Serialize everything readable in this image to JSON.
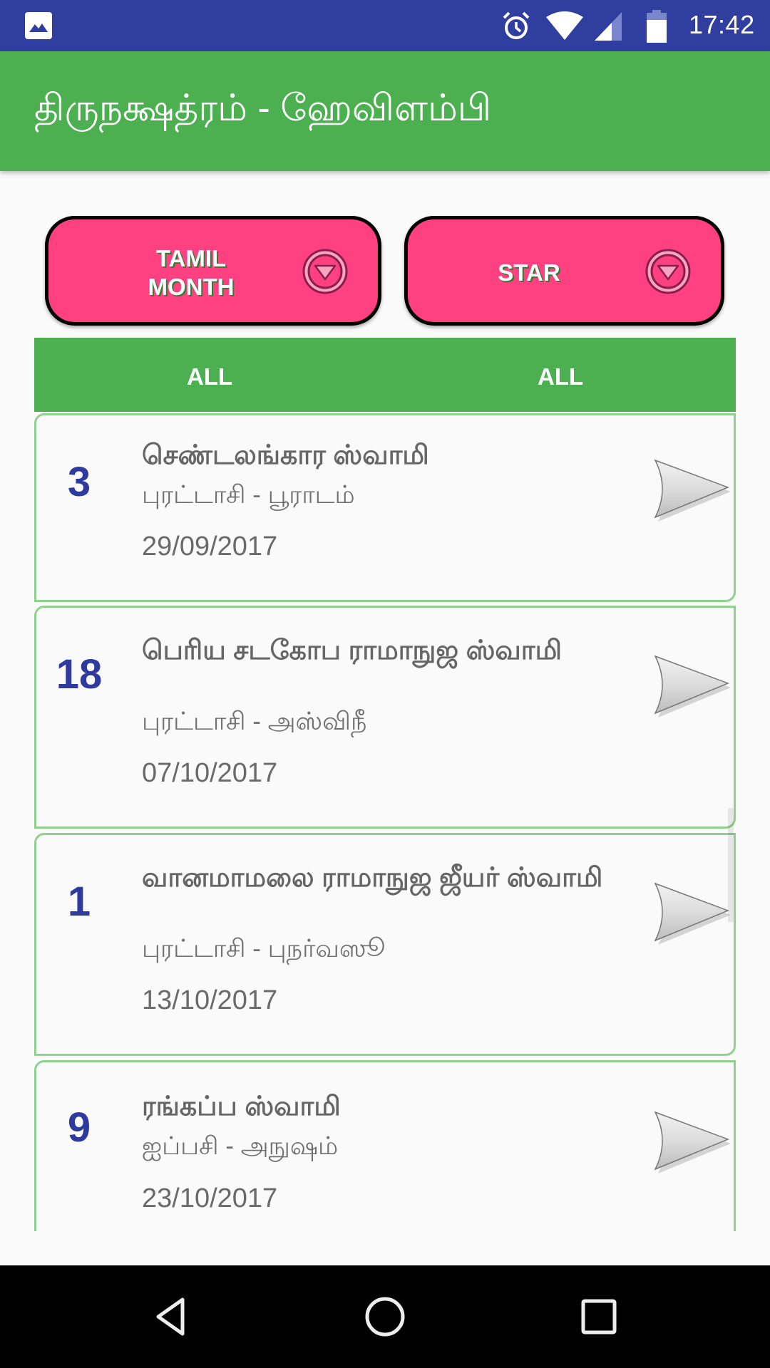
{
  "status_bar": {
    "time": "17:42",
    "icons": [
      "gallery-notification-icon",
      "alarm-icon",
      "wifi-icon",
      "signal-icon",
      "battery-icon"
    ],
    "color": "#303F9F"
  },
  "app_bar": {
    "title": "திருநக்ஷத்ரம் - ஹேவிளம்பி",
    "color": "#4CAF50"
  },
  "filters": {
    "tamil_month": {
      "label": "TAMIL\nMONTH",
      "icon": "dropdown-circle-icon",
      "selected": "ALL"
    },
    "star": {
      "label": "STAR",
      "icon": "dropdown-circle-icon",
      "selected": "ALL"
    },
    "button_color": "#FF4081"
  },
  "list": {
    "items": [
      {
        "number": "3",
        "name": "செண்டலங்கார ஸ்வாமி",
        "month_star": "புரட்டாசி - பூராடம்",
        "date": "29/09/2017"
      },
      {
        "number": "18",
        "name": "பெரிய சடகோப ராமாநுஜ ஸ்வாமி",
        "month_star": "புரட்டாசி - அஸ்விநீ",
        "date": "07/10/2017"
      },
      {
        "number": "1",
        "name": "வானமாமலை ராமாநுஜ ஜீயர் ஸ்வாமி",
        "month_star": "புரட்டாசி - புநர்வஸூ",
        "date": "13/10/2017"
      },
      {
        "number": "9",
        "name": "ரங்கப்ப ஸ்வாமி",
        "month_star": "ஐப்பசி - அநுஷம்",
        "date": "23/10/2017"
      }
    ],
    "number_color": "#2E3A9E",
    "border_color": "#8FD18F"
  },
  "nav_bar": {
    "buttons": [
      "back",
      "home",
      "recents"
    ]
  }
}
